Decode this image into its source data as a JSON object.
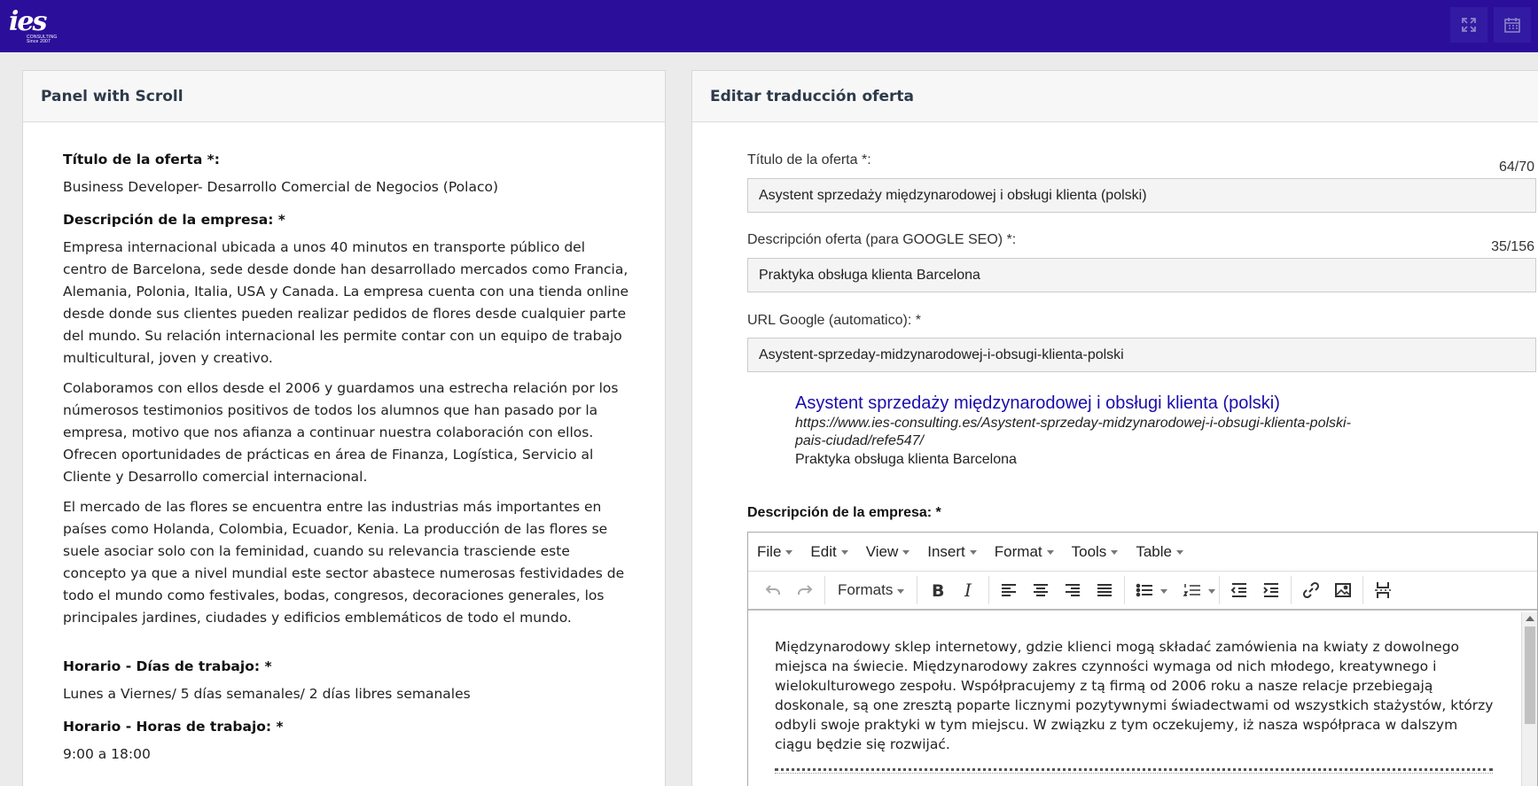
{
  "topbar": {
    "logo_text": "ies",
    "logo_subtext": "CONSULTING Since 2007",
    "fullscreen_icon": "expand-icon",
    "calendar_icon": "calendar-icon",
    "bg_color": "#2b0f9a"
  },
  "left_panel": {
    "title": "Panel with Scroll",
    "titulo_label": "Título de la oferta *:",
    "titulo_value": "Business Developer- Desarrollo Comercial de Negocios (Polaco)",
    "descripcion_label": "Descripción de la empresa: *",
    "paragraphs": [
      "Empresa internacional ubicada a unos 40 minutos en transporte público del centro de Barcelona, sede desde donde han desarrollado mercados como Francia, Alemania, Polonia, Italia, USA y Canada. La empresa cuenta con una tienda online desde donde sus clientes pueden realizar pedidos de flores desde cualquier parte del mundo. Su relación internacional les permite contar con un equipo de trabajo multicultural, joven y creativo.",
      "Colaboramos con ellos desde el 2006 y guardamos una estrecha relación por los númerosos testimonios positivos de todos los alumnos que han pasado por la empresa, motivo que nos afianza a continuar nuestra colaboración con ellos.  Ofrecen oportunidades de prácticas en área de Finanza, Logística, Servicio al Cliente y Desarrollo comercial internacional.",
      "El mercado de las flores se encuentra entre las industrias más importantes en países como Holanda, Colombia, Ecuador, Kenia. La producción de las flores se suele asociar solo con la feminidad, cuando su relevancia trasciende este concepto ya que a nivel mundial este sector abastece numerosas festividades de todo el mundo como festivales, bodas, congresos, decoraciones generales, los principales jardines, ciudades y edificios emblemáticos de todo el mundo."
    ],
    "dias_label": "Horario - Días de trabajo: *",
    "dias_value": "Lunes a Viernes/ 5 días semanales/ 2 días libres semanales",
    "horas_label": "Horario - Horas de trabajo: *",
    "horas_value": "9:00 a 18:00"
  },
  "right_panel": {
    "title": "Editar traducción oferta",
    "titulo_label": "Título de la oferta *:",
    "titulo_count": "64/70",
    "titulo_value": "Asystent sprzedaży międzynarodowej i obsługi klienta (polski)",
    "seo_label": "Descripción oferta (para GOOGLE SEO) *:",
    "seo_count": "35/156",
    "seo_value": "Praktyka obsługa klienta Barcelona",
    "url_label": "URL Google (automatico): *",
    "url_value": "Asystent-sprzeday-midzynarodowej-i-obsugi-klienta-polski",
    "preview": {
      "title": "Asystent sprzedaży międzynarodowej i obsługi klienta (polski)",
      "url": "https://www.ies-consulting.es/Asystent-sprzeday-midzynarodowej-i-obsugi-klienta-polski-pais-ciudad/refe547/",
      "description": "Praktyka obsługa klienta Barcelona",
      "title_color": "#1a0dab"
    },
    "editor_label": "Descripción de la empresa: *",
    "editor": {
      "menus": [
        "File",
        "Edit",
        "View",
        "Insert",
        "Format",
        "Tools",
        "Table"
      ],
      "formats_label": "Formats",
      "content": "Międzynarodowy sklep internetowy, gdzie klienci mogą składać zamówienia na kwiaty z dowolnego miejsca na świecie. Międzynarodowy zakres czynności wymaga od nich młodego, kreatywnego i wielokulturowego zespołu. Współpracujemy z tą firmą od 2006 roku a nasze relacje przebiegają doskonale, są one zresztą poparte licznymi pozytywnymi świadectwami od wszystkich stażystów, którzy odbyli swoje praktyki w tym miejscu. W związku z tym oczekujemy, iż nasza współpraca w dalszym ciągu będzie się rozwijać."
    }
  }
}
